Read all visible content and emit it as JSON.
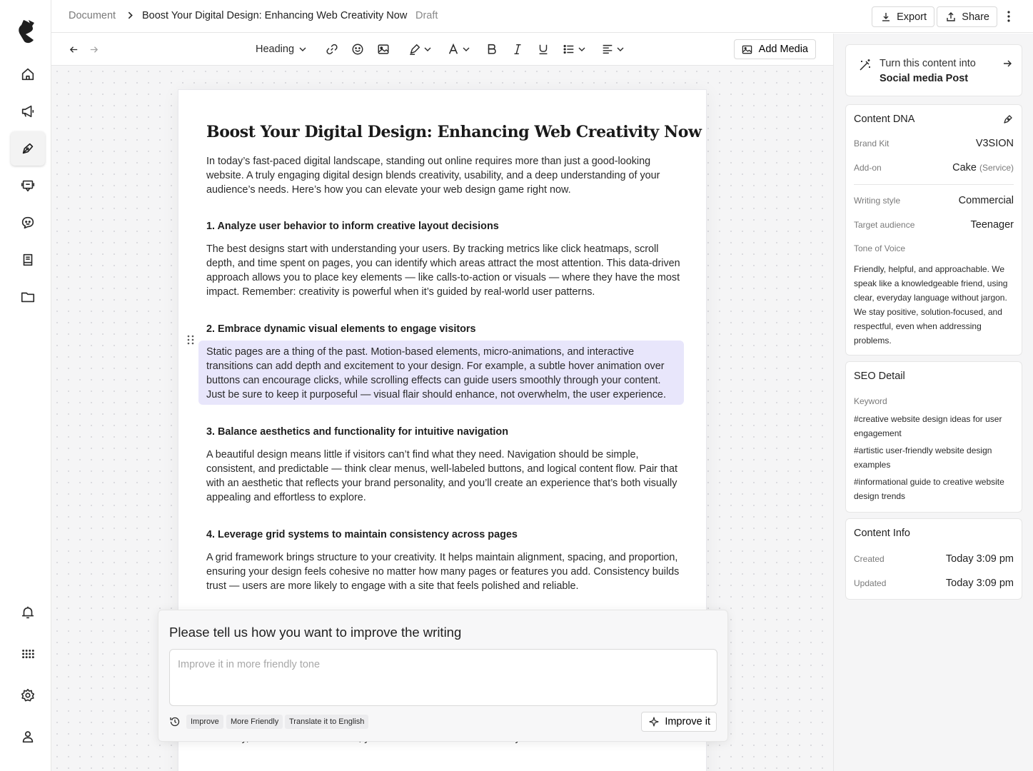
{
  "breadcrumb": {
    "root": "Document",
    "title": "Boost Your Digital Design: Enhancing Web Creativity Now",
    "status": "Draft"
  },
  "topbar": {
    "export_label": "Export",
    "share_label": "Share"
  },
  "toolbar": {
    "block_type": "Heading",
    "add_media_label": "Add Media"
  },
  "document": {
    "title": "Boost Your Digital Design: Enhancing Web Creativity Now",
    "intro": "In today’s fast-paced digital landscape, standing out online requires more than just a good-looking website. A truly engaging digital design blends creativity, usability, and a deep understanding of your audience’s needs. Here’s how you can elevate your web design game right now.",
    "sections": [
      {
        "heading": "1. Analyze user behavior to inform creative layout decisions",
        "body": "The best designs start with understanding your users. By tracking metrics like click heatmaps, scroll depth, and time spent on pages, you can identify which areas attract the most attention. This data-driven approach allows you to place key elements — like calls-to-action or visuals — where they have the most impact. Remember: creativity is powerful when it’s guided by real-world user patterns."
      },
      {
        "heading": "2. Embrace dynamic visual elements to engage visitors",
        "body": "Static pages are a thing of the past. Motion-based elements, micro-animations, and interactive transitions can add depth and excitement to your design. For example, a subtle hover animation over buttons can encourage clicks, while scrolling effects can guide users smoothly through your content. Just be sure to keep it purposeful — visual flair should enhance, not overwhelm, the user experience."
      },
      {
        "heading": "3. Balance aesthetics and functionality for intuitive navigation",
        "body": "A beautiful design means little if visitors can’t find what they need. Navigation should be simple, consistent, and predictable — think clear menus, well-labeled buttons, and logical content flow. Pair that with an aesthetic that reflects your brand personality, and you’ll create an experience that’s both visually appealing and effortless to explore."
      },
      {
        "heading": "4. Leverage grid systems to maintain consistency across pages",
        "body": "A grid framework brings structure to your creativity. It helps maintain alignment, spacing, and proportion, ensuring your design feels cohesive no matter how many pages or features you add. Consistency builds trust — users are more likely to engage with a site that feels polished and reliable."
      }
    ],
    "tail_fragment": "creativity, and interactive features, you can create a website that truly stands out."
  },
  "improve": {
    "question": "Please tell us how you want to improve the writing",
    "placeholder": "Improve it in more friendly tone",
    "value": "",
    "chips": [
      "Improve",
      "More Friendly",
      "Translate it to English"
    ],
    "submit_label": "Improve it"
  },
  "turn_into": {
    "line1": "Turn this content into",
    "line2": "Social media Post"
  },
  "content_dna": {
    "title": "Content DNA",
    "brand_kit_label": "Brand Kit",
    "brand_kit_value": "V3SION",
    "addon_label": "Add-on",
    "addon_value": "Cake",
    "addon_type": "(Service)",
    "writing_style_label": "Writing style",
    "writing_style_value": "Commercial",
    "audience_label": "Target audience",
    "audience_value": "Teenager",
    "tone_label": "Tone of Voice",
    "tone_value": "Friendly, helpful, and approachable. We speak like a knowledgeable friend, using clear, everyday language without jargon. We stay positive, solution-focused, and respectful, even when addressing problems."
  },
  "seo": {
    "title": "SEO Detail",
    "keyword_label": "Keyword",
    "keywords": [
      "#creative website design ideas for user engagement",
      "#artistic user-friendly website design examples",
      "#informational guide to creative website design trends"
    ]
  },
  "content_info": {
    "title": "Content Info",
    "created_label": "Created",
    "created_value": "Today 3:09 pm",
    "updated_label": "Updated",
    "updated_value": "Today 3:09 pm"
  },
  "colors": {
    "highlight": "#e8e6fb",
    "canvas": "#f5f5f6",
    "border": "#e6e6e6"
  },
  "icons": {
    "rail": [
      "logo-icon",
      "home-icon",
      "megaphone-icon",
      "pen-icon",
      "chat-screen-icon",
      "chatbot-icon",
      "book-icon",
      "folder-icon",
      "bell-icon",
      "apps-grid-icon",
      "gear-icon",
      "user-icon"
    ],
    "toolbar": [
      "undo-arrow-icon",
      "redo-arrow-icon",
      "chevron-down-icon",
      "link-icon",
      "emoji-icon",
      "image-icon",
      "highlighter-icon",
      "text-color-icon",
      "bold-icon",
      "italic-icon",
      "underline-icon",
      "list-icon",
      "align-icon"
    ]
  }
}
